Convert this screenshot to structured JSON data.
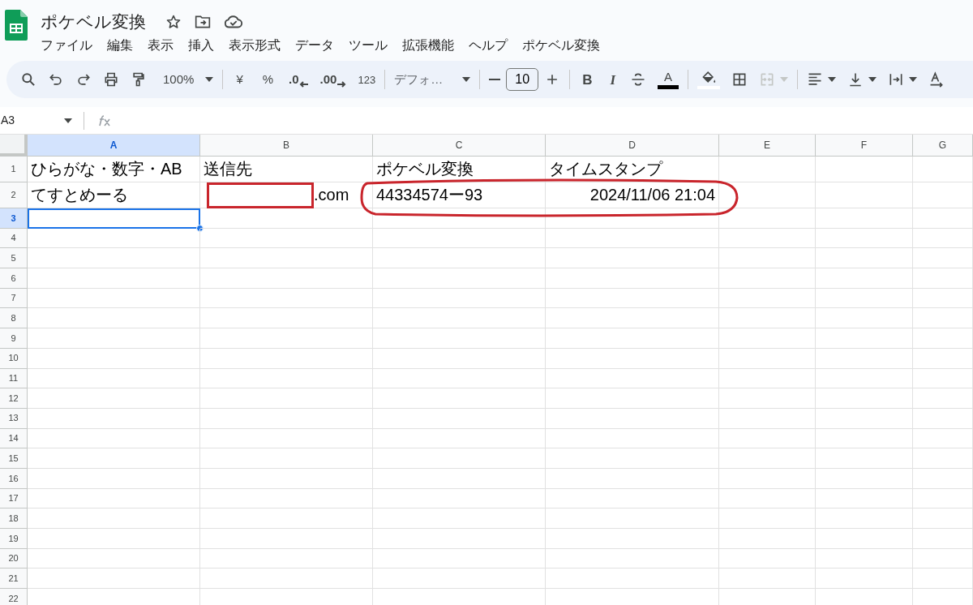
{
  "document": {
    "title": "ポケベル変換"
  },
  "menus": [
    "ファイル",
    "編集",
    "表示",
    "挿入",
    "表示形式",
    "データ",
    "ツール",
    "拡張機能",
    "ヘルプ",
    "ポケベル変換"
  ],
  "toolbar": {
    "zoom": "100%",
    "currency": "¥",
    "percent": "%",
    "decrease_decimals": ".0",
    "increase_decimals": ".00",
    "number_format": "123",
    "font": "デフォ…",
    "font_size": "10",
    "bold": "B",
    "italic": "I",
    "text_color": "A",
    "merge_disabled": true
  },
  "formula_bar": {
    "cell_reference": "A3"
  },
  "columns": [
    {
      "label": "A",
      "selected": true
    },
    {
      "label": "B",
      "selected": false
    },
    {
      "label": "C",
      "selected": false
    },
    {
      "label": "D",
      "selected": false
    },
    {
      "label": "E",
      "selected": false
    },
    {
      "label": "F",
      "selected": false
    },
    {
      "label": "G",
      "selected": false
    }
  ],
  "rows": [
    {
      "label": "1",
      "selected": false,
      "cells": [
        {
          "text": "ひらがな・数字・AB"
        },
        {
          "text": "送信先"
        },
        {
          "text": "ポケベル変換"
        },
        {
          "text": "タイムスタンプ"
        }
      ]
    },
    {
      "label": "2",
      "selected": false,
      "cells": [
        {
          "text": "てすとめーる"
        },
        {
          "text": ".com",
          "redacted": true
        },
        {
          "text": "44334574ー93"
        },
        {
          "text": "2024/11/06 21:04",
          "right_aligned": true
        }
      ]
    },
    {
      "label": "3",
      "selected": true
    },
    {
      "label": "4",
      "selected": false
    },
    {
      "label": "5",
      "selected": false
    },
    {
      "label": "6",
      "selected": false
    },
    {
      "label": "7",
      "selected": false
    },
    {
      "label": "8",
      "selected": false
    },
    {
      "label": "9",
      "selected": false
    },
    {
      "label": "10",
      "selected": false
    },
    {
      "label": "11",
      "selected": false
    },
    {
      "label": "12",
      "selected": false
    },
    {
      "label": "13",
      "selected": false
    },
    {
      "label": "14",
      "selected": false
    },
    {
      "label": "15",
      "selected": false
    },
    {
      "label": "16",
      "selected": false
    },
    {
      "label": "17",
      "selected": false
    },
    {
      "label": "18",
      "selected": false
    },
    {
      "label": "19",
      "selected": false
    },
    {
      "label": "20",
      "selected": false
    },
    {
      "label": "21",
      "selected": false
    },
    {
      "label": "22",
      "selected": false
    }
  ],
  "annotations": [
    {
      "kind": "ellipse"
    }
  ]
}
